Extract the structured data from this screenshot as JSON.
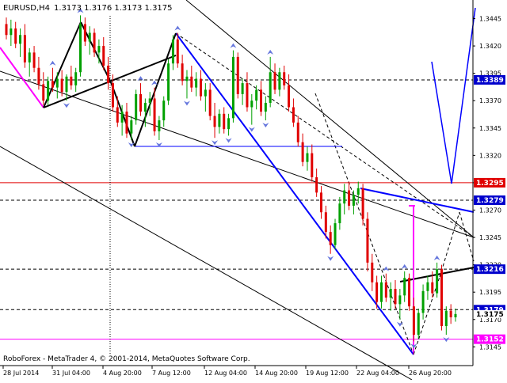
{
  "header": {
    "symbol": "EURUSD,H4",
    "ohlc": "1.3173 1.3176 1.3173 1.3175"
  },
  "footer": {
    "copyright": "RoboForex - MetaTrader 4, © 2001-2014, MetaQuotes Software Corp."
  },
  "colors": {
    "background": "#ffffff",
    "bull_candle": "#00a000",
    "bear_candle": "#e00000",
    "axis_text": "#000000",
    "grid_line": "#000000",
    "trend_line": "#0000ff",
    "support_line": "#0000ff",
    "magenta_line": "#ff00ff",
    "red_line": "#e00000",
    "arrow_marker": "#6677dd",
    "label_blue": "#0000cc",
    "label_red": "#e00000",
    "label_magenta": "#ff00ff"
  },
  "chart_data": {
    "type": "candlestick",
    "title": "EURUSD,H4",
    "ylim": [
      1.3138,
      1.3462
    ],
    "y_ticks": [
      "1.3445",
      "1.3420",
      "1.3395",
      "1.3370",
      "1.3345",
      "1.3320",
      "1.3295",
      "1.3270",
      "1.3245",
      "1.3220",
      "1.3195",
      "1.3170",
      "1.3145"
    ],
    "x_ticks": [
      "28 Jul 2014",
      "31 Jul 04:00",
      "4 Aug 20:00",
      "7 Aug 12:00",
      "12 Aug 04:00",
      "14 Aug 20:00",
      "19 Aug 12:00",
      "22 Aug 04:00",
      "26 Aug 20:00"
    ],
    "candles": [
      [
        1.344,
        1.3446,
        1.3426,
        1.343
      ],
      [
        1.343,
        1.3444,
        1.342,
        1.3436
      ],
      [
        1.3436,
        1.3442,
        1.3418,
        1.3422
      ],
      [
        1.3422,
        1.3436,
        1.341,
        1.343
      ],
      [
        1.343,
        1.344,
        1.34,
        1.3405
      ],
      [
        1.3405,
        1.3418,
        1.3392,
        1.3414
      ],
      [
        1.3414,
        1.342,
        1.3396,
        1.34
      ],
      [
        1.34,
        1.341,
        1.338,
        1.3385
      ],
      [
        1.3385,
        1.3396,
        1.3366,
        1.337
      ],
      [
        1.337,
        1.3392,
        1.3366,
        1.3388
      ],
      [
        1.3388,
        1.34,
        1.3378,
        1.3382
      ],
      [
        1.3382,
        1.3396,
        1.3372,
        1.339
      ],
      [
        1.339,
        1.3398,
        1.3374,
        1.3378
      ],
      [
        1.3378,
        1.3394,
        1.337,
        1.3392
      ],
      [
        1.3392,
        1.3402,
        1.338,
        1.3384
      ],
      [
        1.3384,
        1.34,
        1.3378,
        1.3396
      ],
      [
        1.3396,
        1.3448,
        1.3392,
        1.344
      ],
      [
        1.344,
        1.3446,
        1.342,
        1.3424
      ],
      [
        1.3424,
        1.3438,
        1.3412,
        1.3432
      ],
      [
        1.3432,
        1.3436,
        1.341,
        1.3414
      ],
      [
        1.3414,
        1.3426,
        1.3404,
        1.342
      ],
      [
        1.342,
        1.3428,
        1.3398,
        1.3402
      ],
      [
        1.3402,
        1.341,
        1.338,
        1.3386
      ],
      [
        1.3386,
        1.3394,
        1.336,
        1.3364
      ],
      [
        1.3364,
        1.3374,
        1.3346,
        1.335
      ],
      [
        1.335,
        1.3366,
        1.3338,
        1.336
      ],
      [
        1.336,
        1.3368,
        1.3336,
        1.334
      ],
      [
        1.334,
        1.3356,
        1.3334,
        1.3352
      ],
      [
        1.3352,
        1.338,
        1.3348,
        1.3376
      ],
      [
        1.3376,
        1.3386,
        1.3356,
        1.336
      ],
      [
        1.336,
        1.3372,
        1.3346,
        1.3368
      ],
      [
        1.3368,
        1.3378,
        1.3356,
        1.3372
      ],
      [
        1.3372,
        1.3382,
        1.3338,
        1.3342
      ],
      [
        1.3342,
        1.3356,
        1.3334,
        1.3352
      ],
      [
        1.3352,
        1.3374,
        1.3346,
        1.337
      ],
      [
        1.337,
        1.3408,
        1.3366,
        1.3404
      ],
      [
        1.3404,
        1.343,
        1.3398,
        1.3426
      ],
      [
        1.3426,
        1.3432,
        1.34,
        1.3404
      ],
      [
        1.3404,
        1.3412,
        1.3384,
        1.3388
      ],
      [
        1.3388,
        1.3398,
        1.3372,
        1.3392
      ],
      [
        1.3392,
        1.3402,
        1.3378,
        1.3382
      ],
      [
        1.3382,
        1.3396,
        1.3374,
        1.339
      ],
      [
        1.339,
        1.3398,
        1.337,
        1.3374
      ],
      [
        1.3374,
        1.3386,
        1.336,
        1.338
      ],
      [
        1.338,
        1.3386,
        1.3352,
        1.3356
      ],
      [
        1.3356,
        1.3368,
        1.3336,
        1.3346
      ],
      [
        1.3346,
        1.3362,
        1.334,
        1.3358
      ],
      [
        1.3358,
        1.3364,
        1.334,
        1.3344
      ],
      [
        1.3344,
        1.3358,
        1.3338,
        1.3354
      ],
      [
        1.3354,
        1.3416,
        1.335,
        1.341
      ],
      [
        1.341,
        1.3414,
        1.3372,
        1.3376
      ],
      [
        1.3376,
        1.339,
        1.3366,
        1.3386
      ],
      [
        1.3386,
        1.3396,
        1.336,
        1.3364
      ],
      [
        1.3364,
        1.3376,
        1.3348,
        1.337
      ],
      [
        1.337,
        1.3384,
        1.3362,
        1.338
      ],
      [
        1.338,
        1.3388,
        1.3356,
        1.336
      ],
      [
        1.336,
        1.3374,
        1.3352,
        1.3368
      ],
      [
        1.3368,
        1.341,
        1.3364,
        1.3396
      ],
      [
        1.3396,
        1.3404,
        1.3376,
        1.338
      ],
      [
        1.338,
        1.34,
        1.3374,
        1.3396
      ],
      [
        1.3396,
        1.3402,
        1.338,
        1.3384
      ],
      [
        1.3384,
        1.3394,
        1.336,
        1.3364
      ],
      [
        1.3364,
        1.3372,
        1.3346,
        1.335
      ],
      [
        1.335,
        1.3356,
        1.3328,
        1.3332
      ],
      [
        1.3332,
        1.334,
        1.331,
        1.3314
      ],
      [
        1.3314,
        1.3328,
        1.3306,
        1.3322
      ],
      [
        1.3322,
        1.333,
        1.3296,
        1.33
      ],
      [
        1.33,
        1.3308,
        1.3282,
        1.3286
      ],
      [
        1.3286,
        1.3292,
        1.3262,
        1.3268
      ],
      [
        1.3268,
        1.3274,
        1.3244,
        1.325
      ],
      [
        1.325,
        1.3256,
        1.323,
        1.3238
      ],
      [
        1.3238,
        1.3262,
        1.3234,
        1.3258
      ],
      [
        1.3258,
        1.3282,
        1.3252,
        1.3276
      ],
      [
        1.3276,
        1.3294,
        1.3266,
        1.3288
      ],
      [
        1.3288,
        1.3296,
        1.327,
        1.3274
      ],
      [
        1.3274,
        1.3288,
        1.3266,
        1.3284
      ],
      [
        1.3284,
        1.3296,
        1.3276,
        1.329
      ],
      [
        1.329,
        1.3294,
        1.3256,
        1.3262
      ],
      [
        1.3262,
        1.3268,
        1.3214,
        1.3222
      ],
      [
        1.3222,
        1.323,
        1.3196,
        1.3204
      ],
      [
        1.3204,
        1.321,
        1.318,
        1.3186
      ],
      [
        1.3186,
        1.321,
        1.318,
        1.3204
      ],
      [
        1.3204,
        1.3212,
        1.3186,
        1.319
      ],
      [
        1.319,
        1.3204,
        1.3178,
        1.3198
      ],
      [
        1.3198,
        1.3206,
        1.318,
        1.3184
      ],
      [
        1.3184,
        1.3198,
        1.317,
        1.3192
      ],
      [
        1.3192,
        1.3214,
        1.3186,
        1.3208
      ],
      [
        1.3208,
        1.3212,
        1.3178,
        1.3182
      ],
      [
        1.3182,
        1.319,
        1.315,
        1.3156
      ],
      [
        1.3156,
        1.318,
        1.3152,
        1.3176
      ],
      [
        1.3176,
        1.3202,
        1.317,
        1.3196
      ],
      [
        1.3196,
        1.321,
        1.3188,
        1.3204
      ],
      [
        1.3204,
        1.3214,
        1.319,
        1.3194
      ],
      [
        1.3194,
        1.3222,
        1.319,
        1.3216
      ],
      [
        1.3216,
        1.322,
        1.316,
        1.3164
      ],
      [
        1.3164,
        1.3182,
        1.3156,
        1.3178
      ],
      [
        1.3178,
        1.3184,
        1.3166,
        1.3172
      ],
      [
        1.3172,
        1.318,
        1.3168,
        1.3175
      ]
    ],
    "price_labels": [
      {
        "text": "1.3389",
        "value": 1.3389,
        "style": "blue",
        "line": "dashed"
      },
      {
        "text": "1.3295",
        "value": 1.3295,
        "style": "red",
        "line": "solid-red"
      },
      {
        "text": "1.3279",
        "value": 1.3279,
        "style": "blue",
        "line": "dashed"
      },
      {
        "text": "1.3216",
        "value": 1.3216,
        "style": "blue",
        "line": "dashed"
      },
      {
        "text": "1.3179",
        "value": 1.3179,
        "style": "blue",
        "line": "dashed"
      },
      {
        "text": "1.3175",
        "value": 1.3175,
        "style": "current",
        "line": "none"
      },
      {
        "text": "1.3152",
        "value": 1.3152,
        "style": "magenta",
        "line": "solid-magenta"
      }
    ],
    "grid": false,
    "legend": "none"
  }
}
